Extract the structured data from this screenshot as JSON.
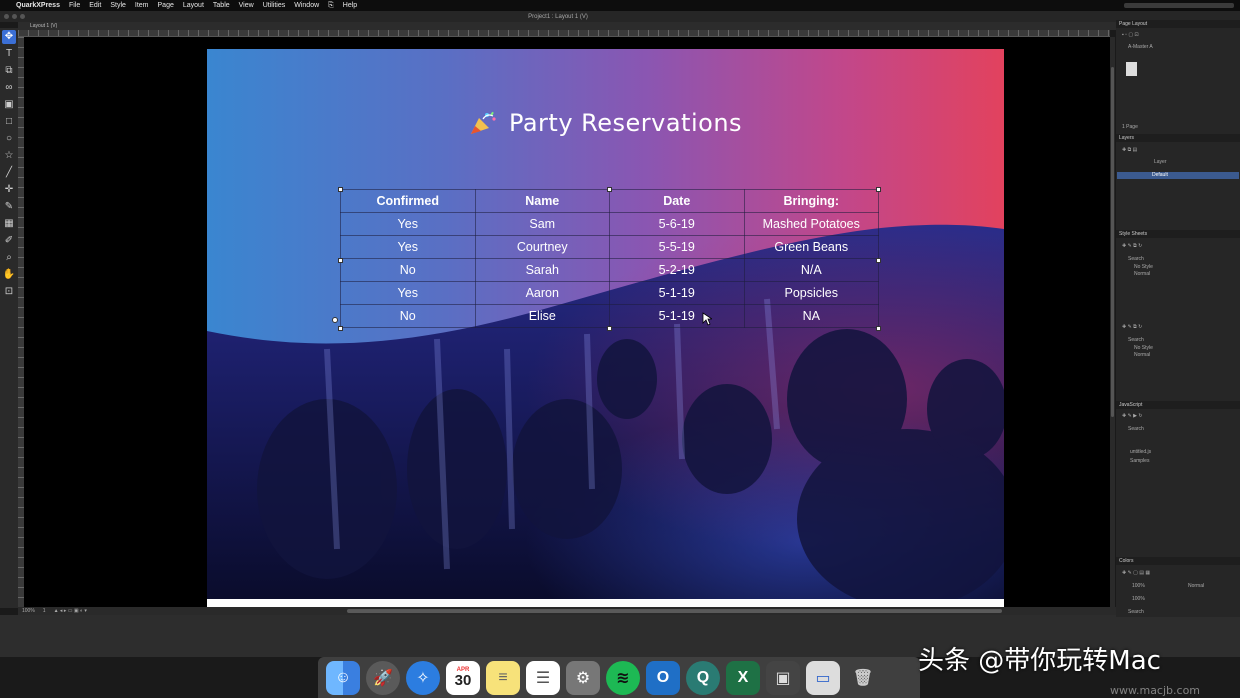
{
  "menubar": {
    "app": "QuarkXPress",
    "items": [
      "File",
      "Edit",
      "Style",
      "Item",
      "Page",
      "Layout",
      "Table",
      "View",
      "Utilities",
      "Window",
      "Help"
    ]
  },
  "window": {
    "title": "Project1 : Layout 1 (V)",
    "tab": "Layout 1 (V)",
    "zoom": "100%",
    "page_number": "1"
  },
  "document": {
    "title": "Party Reservations",
    "table": {
      "headers": [
        "Confirmed",
        "Name",
        "Date",
        "Bringing:"
      ],
      "rows": [
        [
          "Yes",
          "Sam",
          "5-6-19",
          "Mashed Potatoes"
        ],
        [
          "Yes",
          "Courtney",
          "5-5-19",
          "Green Beans"
        ],
        [
          "No",
          "Sarah",
          "5-2-19",
          "N/A"
        ],
        [
          "Yes",
          "Aaron",
          "5-1-19",
          "Popsicles"
        ],
        [
          "No",
          "Elise",
          "5-1-19",
          "NA"
        ]
      ]
    }
  },
  "panels": {
    "page_layout": {
      "title": "Page Layout",
      "master": "A-Master A",
      "pages": "1 Page"
    },
    "layers": {
      "title": "Layers",
      "rows": [
        "Layer",
        "Default"
      ]
    },
    "style_sheets": {
      "title": "Style Sheets",
      "search": "Search",
      "rows": [
        "No Style",
        "Normal"
      ],
      "rows2": [
        "No Style",
        "Normal"
      ]
    },
    "javascript": {
      "title": "JavaScript",
      "search": "Search",
      "rows": [
        "untitled.js",
        "Samples"
      ]
    },
    "colors": {
      "title": "Colors",
      "pct1": "100%",
      "pct2": "100%",
      "mode": "Normal",
      "search": "Search"
    }
  },
  "dock": {
    "calendar_month": "APR",
    "calendar_day": "30",
    "icons": [
      "finder-icon",
      "launchpad-icon",
      "safari-icon",
      "calendar-icon",
      "notes-icon",
      "reminders-icon",
      "system-preferences-icon",
      "spotify-icon",
      "outlook-icon",
      "quarkxpress-icon",
      "excel-icon",
      "screenshot-icon",
      "preview-icon",
      "trash-icon"
    ]
  },
  "watermark": {
    "text": "头条 @带你玩转Mac",
    "site": "www.macjb.com"
  },
  "colors": {
    "accent": "#3b6fd6",
    "page_left": "#3a86d0",
    "page_right": "#e2425e"
  }
}
